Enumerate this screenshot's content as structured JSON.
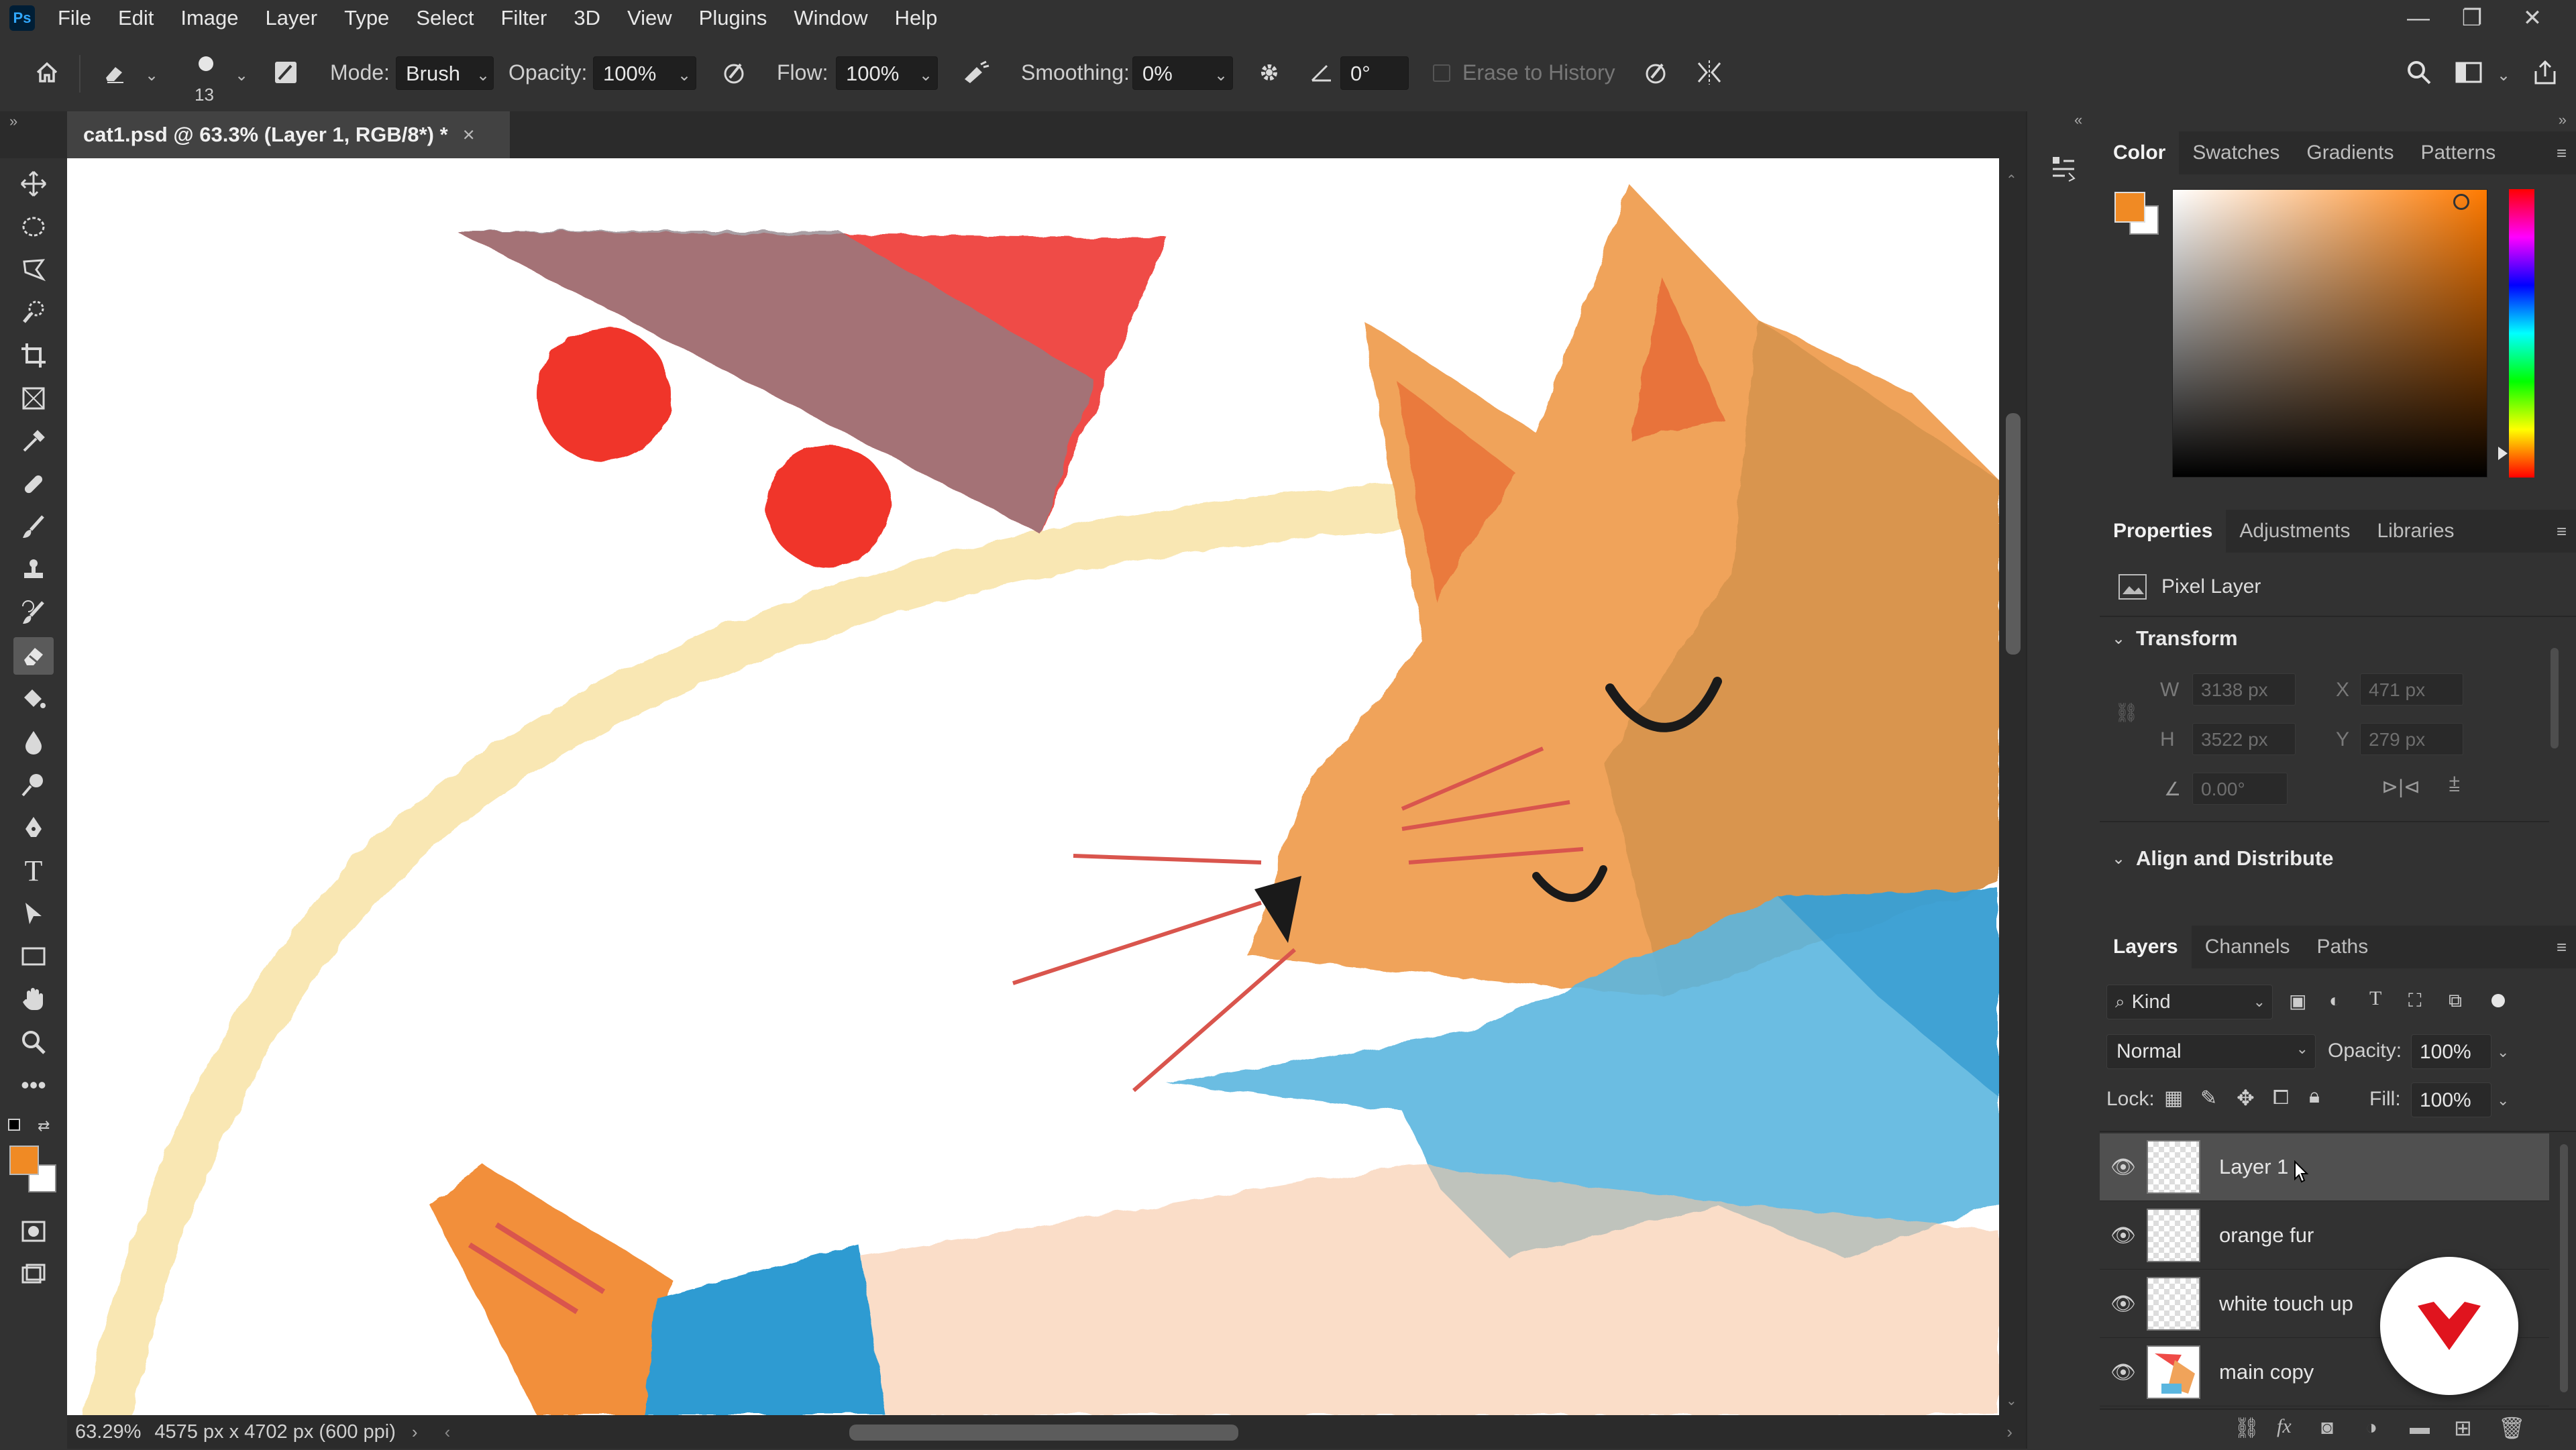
{
  "app": {
    "logo": "Ps"
  },
  "menu": [
    "File",
    "Edit",
    "Image",
    "Layer",
    "Type",
    "Select",
    "Filter",
    "3D",
    "View",
    "Plugins",
    "Window",
    "Help"
  ],
  "window_controls": {
    "minimize": "—",
    "restore": "❐",
    "close": "✕"
  },
  "options": {
    "brush_size": "13",
    "mode_label": "Mode:",
    "mode_value": "Brush",
    "opacity_label": "Opacity:",
    "opacity_value": "100%",
    "flow_label": "Flow:",
    "flow_value": "100%",
    "smoothing_label": "Smoothing:",
    "smoothing_value": "0%",
    "angle_value": "0°",
    "erase_to_history": "Erase to History"
  },
  "document": {
    "tab_title": "cat1.psd @ 63.3% (Layer 1, RGB/8*) *",
    "close": "×"
  },
  "status": {
    "zoom": "63.29%",
    "info": "4575 px x 4702 px (600 ppi)"
  },
  "colors": {
    "foreground": "#f08a24",
    "background": "#ffffff",
    "picker_hue": "#ff7a00"
  },
  "color_panel": {
    "tabs": [
      "Color",
      "Swatches",
      "Gradients",
      "Patterns"
    ]
  },
  "properties_panel": {
    "tabs": [
      "Properties",
      "Adjustments",
      "Libraries"
    ],
    "layer_type": "Pixel Layer",
    "transform_title": "Transform",
    "w_label": "W",
    "w_value": "3138 px",
    "x_label": "X",
    "x_value": "471 px",
    "h_label": "H",
    "h_value": "3522 px",
    "y_label": "Y",
    "y_value": "279 px",
    "angle_value": "0.00°",
    "align_title": "Align and Distribute"
  },
  "layers_panel": {
    "tabs": [
      "Layers",
      "Channels",
      "Paths"
    ],
    "filter_kind": "Kind",
    "blend_mode": "Normal",
    "opacity_label": "Opacity:",
    "opacity_value": "100%",
    "lock_label": "Lock:",
    "fill_label": "Fill:",
    "fill_value": "100%",
    "layers": [
      {
        "name": "Layer 1",
        "selected": true
      },
      {
        "name": "orange fur",
        "selected": false
      },
      {
        "name": "white touch up",
        "selected": false
      },
      {
        "name": "main copy",
        "selected": false
      }
    ]
  }
}
